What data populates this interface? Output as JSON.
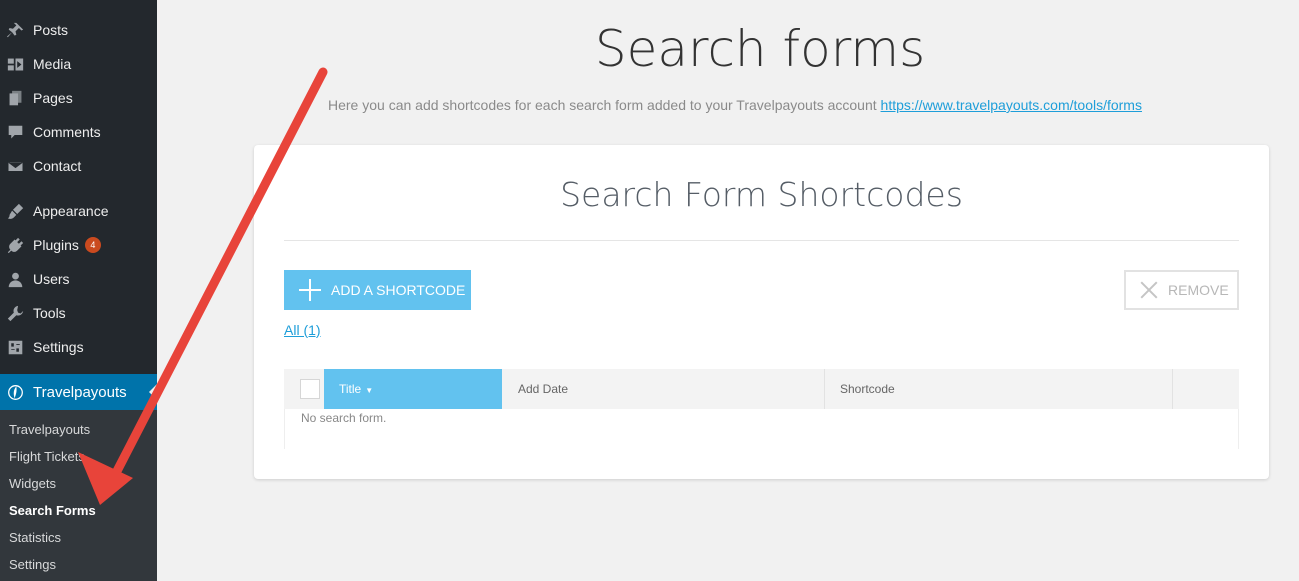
{
  "sidebar": {
    "items": [
      {
        "label": "Posts",
        "icon": "pin-icon"
      },
      {
        "label": "Media",
        "icon": "media-icon"
      },
      {
        "label": "Pages",
        "icon": "pages-icon"
      },
      {
        "label": "Comments",
        "icon": "comment-icon"
      },
      {
        "label": "Contact",
        "icon": "envelope-icon"
      },
      {
        "label": "Appearance",
        "icon": "brush-icon"
      },
      {
        "label": "Plugins",
        "icon": "plug-icon",
        "badge": "4"
      },
      {
        "label": "Users",
        "icon": "user-icon"
      },
      {
        "label": "Tools",
        "icon": "wrench-icon"
      },
      {
        "label": "Settings",
        "icon": "settings-icon"
      }
    ],
    "active": {
      "label": "Travelpayouts",
      "icon": "travelpayouts-icon"
    },
    "submenu": [
      "Travelpayouts",
      "Flight Tickets",
      "Widgets",
      "Search Forms",
      "Statistics",
      "Settings"
    ],
    "current_submenu": "Search Forms"
  },
  "main": {
    "title": "Search forms",
    "description": "Here you can add shortcodes for each search form added to your Travelpayouts account",
    "description_link": "https://www.travelpayouts.com/tools/forms"
  },
  "card": {
    "title": "Search Form Shortcodes",
    "add_button": "ADD A SHORTCODE",
    "remove_button": "REMOVE",
    "filter_all": "All (1)",
    "table": {
      "columns": [
        "Title",
        "Add Date",
        "Shortcode"
      ],
      "empty_message": "No search form."
    }
  },
  "colors": {
    "sidebar_bg": "#23282d",
    "active_bg": "#0073aa",
    "accent": "#62c2ef",
    "link": "#1e9ed9",
    "badge": "#ca4a1f",
    "annotation_arrow": "#e8443a"
  }
}
